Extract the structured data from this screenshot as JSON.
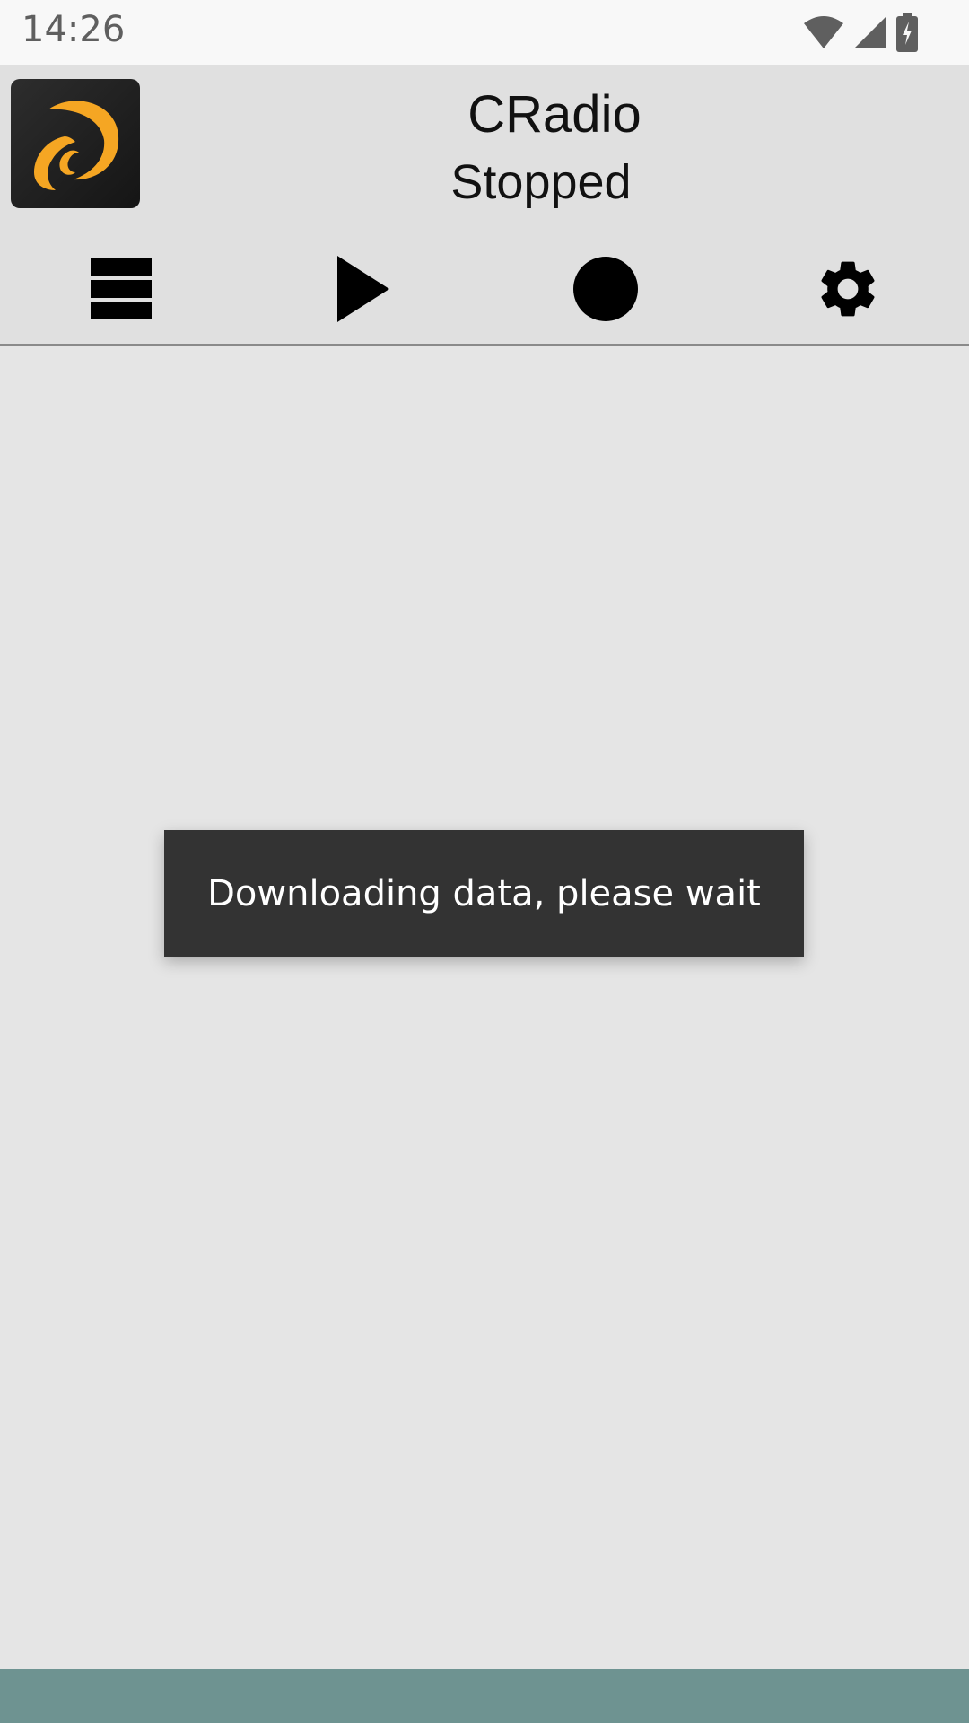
{
  "status_bar": {
    "time": "14:26",
    "icons": [
      "wifi-icon",
      "cell-signal-icon",
      "battery-charging-icon"
    ]
  },
  "header": {
    "app_name": "CRadio",
    "playback_state": "Stopped",
    "toolbar": [
      {
        "name": "list-button",
        "icon": "list-icon"
      },
      {
        "name": "play-button",
        "icon": "play-icon"
      },
      {
        "name": "record-button",
        "icon": "record-icon"
      },
      {
        "name": "settings-button",
        "icon": "gear-icon"
      }
    ]
  },
  "toast": {
    "message": "Downloading data, please wait"
  },
  "colors": {
    "header_bg": "#e0e0e0",
    "content_bg": "#e5e5e5",
    "toast_bg": "#333333",
    "bottom_bar": "#6e9391",
    "logo_accent": "#f5a623"
  }
}
